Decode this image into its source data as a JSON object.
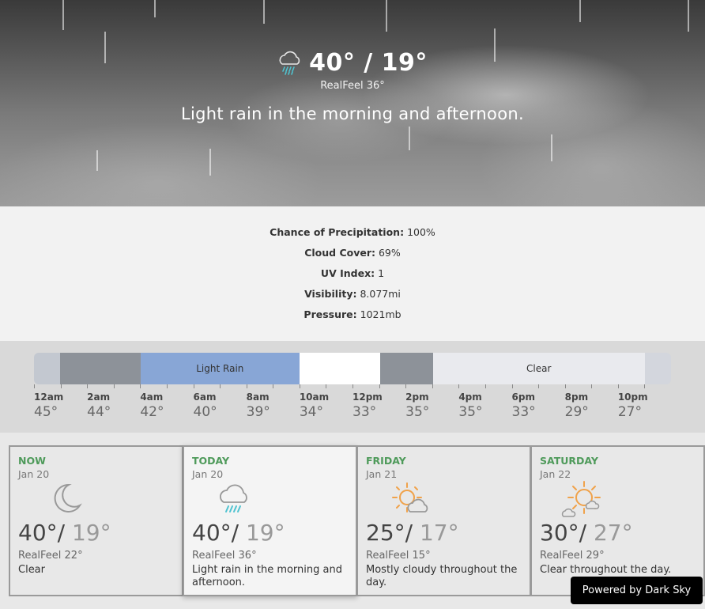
{
  "hero": {
    "icon": "rain-cloud-icon",
    "temp": "40° / 19°",
    "realfeel": "RealFeel 36°",
    "summary": "Light rain in the morning and afternoon."
  },
  "details": [
    {
      "label": "Chance of Precipitation:",
      "value": "100%"
    },
    {
      "label": "Cloud Cover:",
      "value": "69%"
    },
    {
      "label": "UV Index:",
      "value": "1"
    },
    {
      "label": "Visibility:",
      "value": "8.077mi"
    },
    {
      "label": "Pressure:",
      "value": "1021mb"
    }
  ],
  "timeline": {
    "segments": [
      {
        "label": "",
        "color": "#c3c8d0",
        "span": 0.041
      },
      {
        "label": "",
        "color": "#8d9299",
        "span": 0.126
      },
      {
        "label": "Light Rain",
        "color": "#88a6d6",
        "span": 0.25
      },
      {
        "label": "",
        "color": "#ffffff",
        "span": 0.126
      },
      {
        "label": "",
        "color": "#8d9299",
        "span": 0.083
      },
      {
        "label": "Clear",
        "color": "#e9eaee",
        "span": 0.333
      },
      {
        "label": "",
        "color": "#d3d6dd",
        "span": 0.041
      }
    ],
    "hours": [
      {
        "time": "12am",
        "temp": "45°"
      },
      {
        "time": "2am",
        "temp": "44°"
      },
      {
        "time": "4am",
        "temp": "42°"
      },
      {
        "time": "6am",
        "temp": "40°"
      },
      {
        "time": "8am",
        "temp": "39°"
      },
      {
        "time": "10am",
        "temp": "34°"
      },
      {
        "time": "12pm",
        "temp": "33°"
      },
      {
        "time": "2pm",
        "temp": "35°"
      },
      {
        "time": "4pm",
        "temp": "35°"
      },
      {
        "time": "6pm",
        "temp": "33°"
      },
      {
        "time": "8pm",
        "temp": "29°"
      },
      {
        "time": "10pm",
        "temp": "27°"
      }
    ]
  },
  "forecast": [
    {
      "day": "NOW",
      "date": "Jan 20",
      "icon": "moon-icon",
      "hi": "40°/",
      "lo": " 19°",
      "realfeel": "RealFeel 22°",
      "summary": "Clear"
    },
    {
      "day": "TODAY",
      "date": "Jan 20",
      "icon": "rain-cloud-icon",
      "hi": "40°/",
      "lo": " 19°",
      "realfeel": "RealFeel 36°",
      "summary": "Light rain in the morning and afternoon."
    },
    {
      "day": "FRIDAY",
      "date": "Jan 21",
      "icon": "partly-cloudy-icon",
      "hi": "25°/",
      "lo": " 17°",
      "realfeel": "RealFeel 15°",
      "summary": "Mostly cloudy throughout the day."
    },
    {
      "day": "SATURDAY",
      "date": "Jan 22",
      "icon": "partly-sunny-icon",
      "hi": "30°/",
      "lo": " 27°",
      "realfeel": "RealFeel 29°",
      "summary": "Clear throughout the day."
    }
  ],
  "powered_by": "Powered by Dark Sky"
}
